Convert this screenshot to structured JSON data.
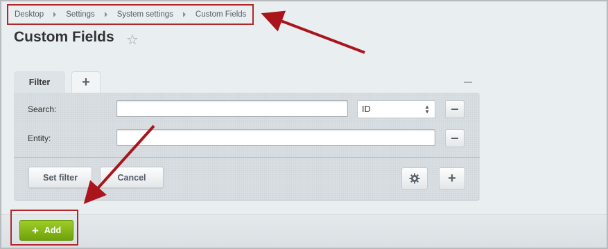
{
  "breadcrumb": {
    "items": [
      "Desktop",
      "Settings",
      "System settings",
      "Custom Fields"
    ]
  },
  "page": {
    "title": "Custom Fields"
  },
  "filter": {
    "tab_label": "Filter",
    "rows": [
      {
        "label": "Search:",
        "value": "",
        "select_value": "ID"
      },
      {
        "label": "Entity:",
        "value": ""
      }
    ],
    "set_filter_label": "Set filter",
    "cancel_label": "Cancel"
  },
  "toolbar": {
    "add_label": "Add"
  },
  "colors": {
    "highlight": "#b3262a",
    "add_button": "#7fb012",
    "background": "#e9eef0"
  },
  "icons": [
    "star-icon",
    "plus-icon",
    "minus-icon",
    "gear-icon",
    "collapse-icon"
  ]
}
